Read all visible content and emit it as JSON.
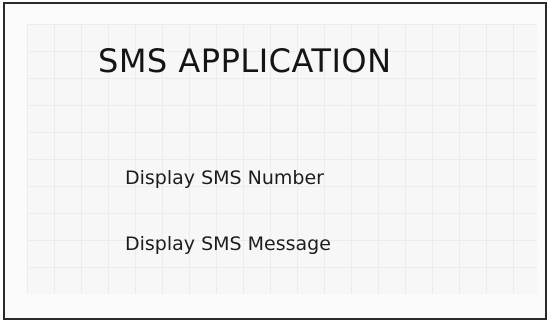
{
  "app": {
    "title": "SMS APPLICATION"
  },
  "fields": {
    "sms_number_label": "Display SMS Number",
    "sms_message_label": "Display SMS Message"
  }
}
